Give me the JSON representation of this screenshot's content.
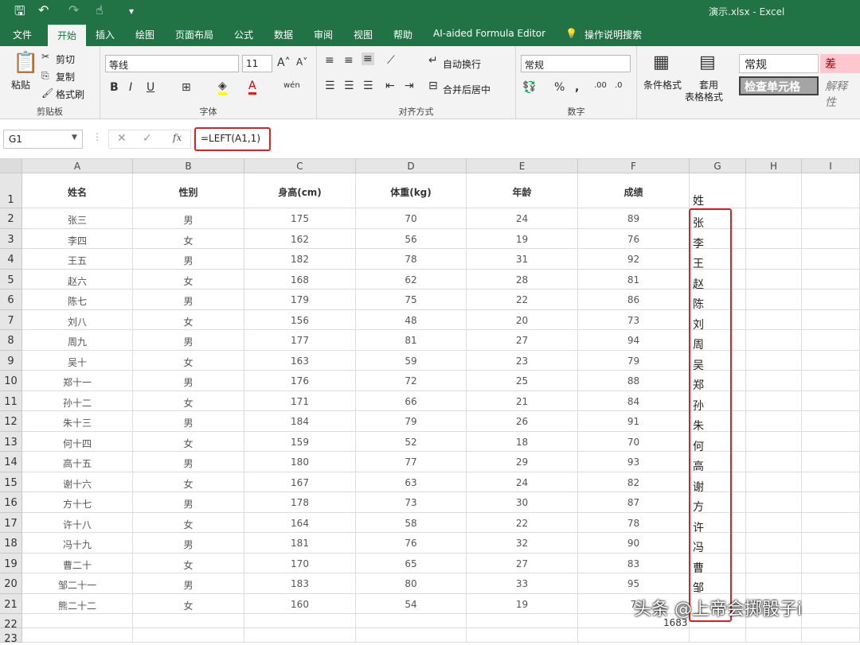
{
  "window": {
    "title": "演示.xlsx  -  Excel"
  },
  "tabs": [
    "文件",
    "开始",
    "插入",
    "绘图",
    "页面布局",
    "公式",
    "数据",
    "审阅",
    "视图",
    "帮助",
    "AI-aided Formula Editor",
    "操作说明搜索"
  ],
  "active_tab": "开始",
  "ribbon": {
    "clipboard": {
      "paste": "粘贴",
      "cut": "剪切",
      "copy": "复制",
      "format_painter": "格式刷",
      "label": "剪贴板"
    },
    "font": {
      "name": "等线",
      "size": "11",
      "label": "字体"
    },
    "alignment": {
      "wrap": "自动换行",
      "merge": "合并后居中",
      "label": "对齐方式"
    },
    "number": {
      "format": "常规",
      "label": "数字"
    },
    "styles": {
      "conditional": "条件格式",
      "table_1": "套用",
      "table_2": "表格格式",
      "normal": "常规",
      "bad": "差",
      "check": "检查单元格",
      "explain": "解释性"
    }
  },
  "formula_bar": {
    "name_box": "G1",
    "formula": "=LEFT(A1,1)"
  },
  "columns": [
    "A",
    "B",
    "C",
    "D",
    "E",
    "F",
    "G",
    "H",
    "I"
  ],
  "header_row": [
    "姓名",
    "性别",
    "身高(cm)",
    "体重(kg)",
    "年龄",
    "成绩",
    "姓"
  ],
  "rows": [
    [
      "张三",
      "男",
      "175",
      "70",
      "24",
      "89",
      "张"
    ],
    [
      "李四",
      "女",
      "162",
      "56",
      "19",
      "76",
      "李"
    ],
    [
      "王五",
      "男",
      "182",
      "78",
      "31",
      "92",
      "王"
    ],
    [
      "赵六",
      "女",
      "168",
      "62",
      "28",
      "81",
      "赵"
    ],
    [
      "陈七",
      "男",
      "179",
      "75",
      "22",
      "86",
      "陈"
    ],
    [
      "刘八",
      "女",
      "156",
      "48",
      "20",
      "73",
      "刘"
    ],
    [
      "周九",
      "男",
      "177",
      "81",
      "27",
      "94",
      "周"
    ],
    [
      "吴十",
      "女",
      "163",
      "59",
      "23",
      "79",
      "吴"
    ],
    [
      "郑十一",
      "男",
      "176",
      "72",
      "25",
      "88",
      "郑"
    ],
    [
      "孙十二",
      "女",
      "171",
      "66",
      "21",
      "84",
      "孙"
    ],
    [
      "朱十三",
      "男",
      "184",
      "79",
      "26",
      "91",
      "朱"
    ],
    [
      "何十四",
      "女",
      "159",
      "52",
      "18",
      "70",
      "何"
    ],
    [
      "高十五",
      "男",
      "180",
      "77",
      "29",
      "93",
      "高"
    ],
    [
      "谢十六",
      "女",
      "167",
      "63",
      "24",
      "82",
      "谢"
    ],
    [
      "方十七",
      "男",
      "178",
      "73",
      "30",
      "87",
      "方"
    ],
    [
      "许十八",
      "女",
      "164",
      "58",
      "22",
      "78",
      "许"
    ],
    [
      "冯十九",
      "男",
      "181",
      "76",
      "32",
      "90",
      "冯"
    ],
    [
      "曹二十",
      "女",
      "170",
      "65",
      "27",
      "83",
      "曹"
    ],
    [
      "邹二十一",
      "男",
      "183",
      "80",
      "33",
      "95",
      "邹"
    ],
    [
      "熊二十二",
      "女",
      "160",
      "54",
      "19",
      "7",
      ""
    ]
  ],
  "row_numbers": [
    "1",
    "2",
    "3",
    "4",
    "5",
    "6",
    "7",
    "8",
    "9",
    "10",
    "11",
    "12",
    "13",
    "14",
    "15",
    "16",
    "17",
    "18",
    "19",
    "20",
    "21",
    "22",
    "23"
  ],
  "watermark": "头条 @上帝会掷骰子i",
  "status_number": "1683",
  "colors": {
    "excel_green": "#217346",
    "highlight_red": "#e02020"
  }
}
